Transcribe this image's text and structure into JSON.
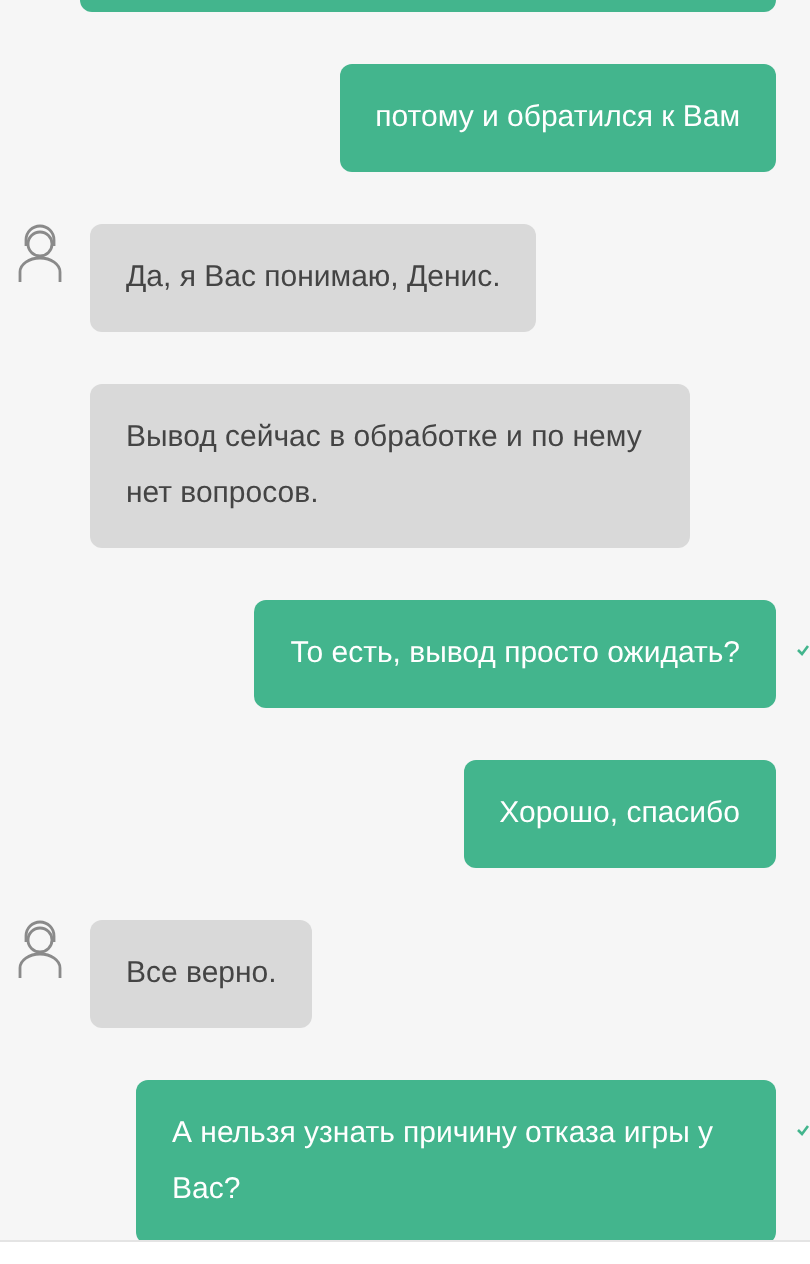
{
  "messages": [
    {
      "kind": "user",
      "text": "потому и обратился к Вам",
      "read": false
    },
    {
      "kind": "agent",
      "text": "Да, я Вас понимаю, Денис.",
      "avatar": true
    },
    {
      "kind": "agent",
      "text": "Вывод сейчас в обработке и по нему нет вопросов.",
      "avatar": false
    },
    {
      "kind": "user",
      "text": "То есть, вывод просто ожидать?",
      "read": true
    },
    {
      "kind": "user",
      "text": "Хорошо, спасибо",
      "read": false
    },
    {
      "kind": "agent",
      "text": "Все верно.",
      "avatar": true
    },
    {
      "kind": "user",
      "text": "А нельзя узнать причину отказа игры у Вас?",
      "read": true
    }
  ]
}
